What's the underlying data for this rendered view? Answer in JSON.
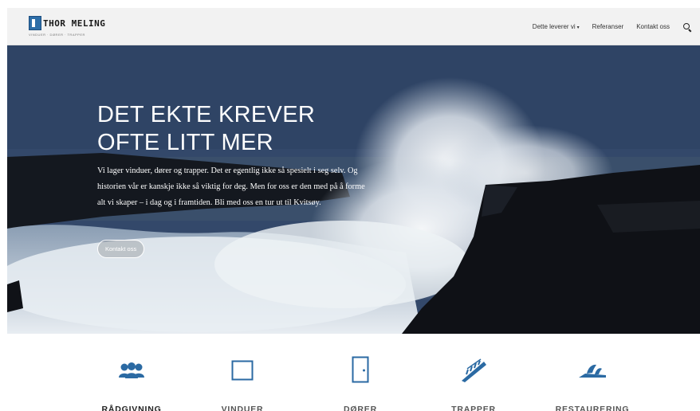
{
  "header": {
    "brand": "THOR MELING",
    "tagline": "VINDUER · DØRER · TRAPPER",
    "nav": [
      {
        "label": "Dette leverer vi",
        "has_caret": true
      },
      {
        "label": "Referanser"
      },
      {
        "label": "Kontakt oss"
      }
    ]
  },
  "hero": {
    "title_line1": "DET EKTE KREVER",
    "title_line2": "OFTE LITT MER",
    "body": "Vi lager vinduer, dører og trapper. Det er egentlig ikke så spesielt i seg selv. Og historien vår er kanskje ikke så viktig for deg. Men for oss er den med på å forme alt vi skaper – i dag og i framtiden. Bli med oss en tur ut til Kvitsøy.",
    "button": "Kontakt oss"
  },
  "services": [
    {
      "label": "RÅDGIVNING",
      "icon": "people-icon",
      "label_color": "#222222"
    },
    {
      "label": "VINDUER",
      "icon": "window-icon",
      "label_color": "#555555"
    },
    {
      "label": "DØRER",
      "icon": "door-icon",
      "label_color": "#555555"
    },
    {
      "label": "TRAPPER",
      "icon": "stairs-icon",
      "label_color": "#555555"
    },
    {
      "label": "RESTAURERING",
      "icon": "plane-tool-icon",
      "label_color": "#555555"
    }
  ],
  "colors": {
    "accent": "#2b6aa3",
    "header_bg": "#f2f2f2",
    "hero_sky": "#34496a"
  }
}
